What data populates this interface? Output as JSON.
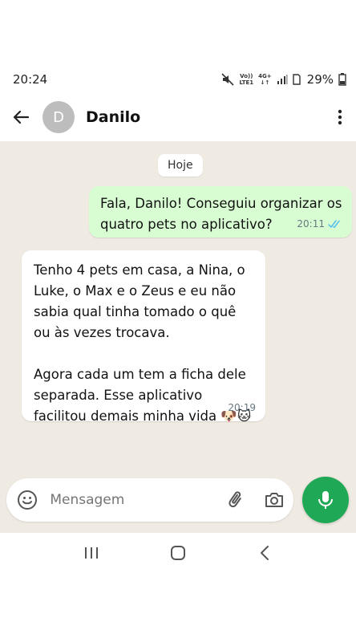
{
  "status_bar": {
    "time": "20:24",
    "network_top": "Vo))",
    "network_bottom": "LTE1",
    "network_gen": "4G+",
    "battery": "29%"
  },
  "header": {
    "avatar_letter": "D",
    "contact_name": "Danilo"
  },
  "chat": {
    "date_chip": "Hoje",
    "messages": [
      {
        "direction": "outgoing",
        "text": "Fala, Danilo! Conseguiu organizar os quatro pets no aplicativo?",
        "time": "20:11",
        "status_icon": "double-check-read-icon"
      },
      {
        "direction": "incoming",
        "text": "Tenho 4 pets em casa, a Nina, o Luke, o Max e o Zeus e eu não sabia qual tinha tomado o quê ou às vezes trocava.\n\nAgora cada um tem a ficha dele separada. Esse aplicativo facilitou demais minha vida 🐶🐱",
        "time": "20:19"
      }
    ]
  },
  "composer": {
    "placeholder": "Mensagem"
  },
  "colors": {
    "outgoing_bubble": "#d9fdd3",
    "chat_background": "#efeae2",
    "accent_green": "#1fa855",
    "read_ticks": "#53bdeb"
  }
}
